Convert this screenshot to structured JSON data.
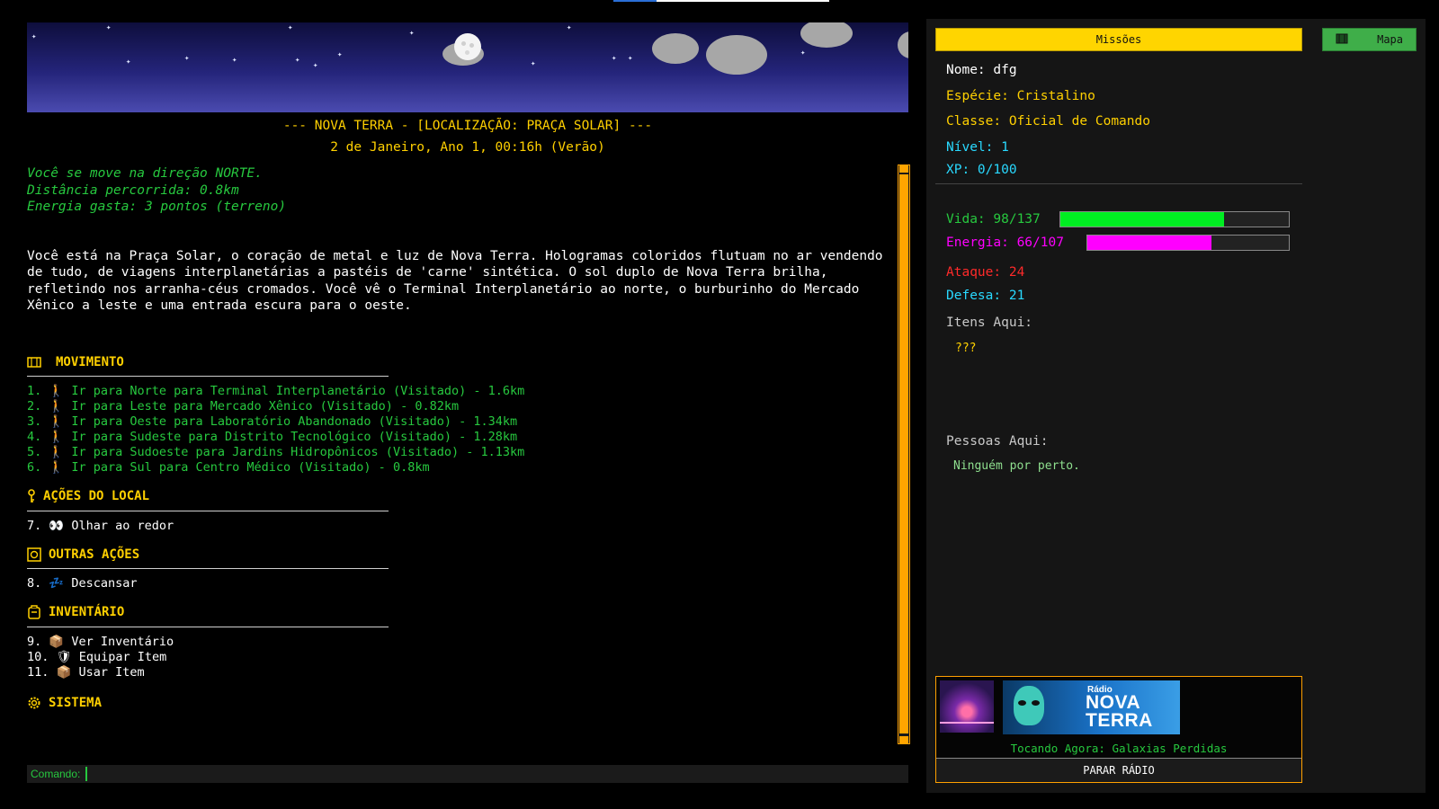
{
  "location_title": "--- NOVA TERRA - [LOCALIZAÇÃO: PRAÇA SOLAR] ---",
  "date_line": "2 de Janeiro, Ano 1, 00:16h (Verão)",
  "movement_messages": [
    "Você se move na direção NORTE.",
    "Distância percorrida: 0.8km",
    "Energia gasta: 3 pontos (terreno)"
  ],
  "description": "Você está na Praça Solar, o coração de metal e luz de Nova Terra. Hologramas coloridos flutuam no ar vendendo de tudo, de viagens interplanetárias a pastéis de 'carne' sintética. O sol duplo de Nova Terra brilha, refletindo nos arranha-céus cromados. Você vê o Terminal Interplanetário ao norte, o burburinho do Mercado Xênico a leste e uma entrada escura para o oeste.",
  "sections": {
    "movimento": {
      "title": "MOVIMENTO",
      "items": [
        "1. 🚶 Ir para Norte para Terminal Interplanetário (Visitado) - 1.6km",
        "2. 🚶 Ir para Leste para Mercado Xênico (Visitado) - 0.82km",
        "3. 🚶 Ir para Oeste para Laboratório Abandonado (Visitado) - 1.34km",
        "4. 🚶 Ir para Sudeste para Distrito Tecnológico (Visitado) - 1.28km",
        "5. 🚶 Ir para Sudoeste para Jardins Hidropônicos (Visitado) - 1.13km",
        "6. 🚶 Ir para Sul para Centro Médico (Visitado) - 0.8km"
      ]
    },
    "acoes_local": {
      "title": "AÇÕES DO LOCAL",
      "items": [
        "7. 👀 Olhar ao redor"
      ]
    },
    "outras_acoes": {
      "title": "OUTRAS AÇÕES",
      "items": [
        "8. 💤 Descansar"
      ]
    },
    "inventario": {
      "title": "INVENTÁRIO",
      "items": [
        "9. 📦 Ver Inventário",
        "10. 🛡   Equipar Item",
        "11. 📦 Usar Item"
      ]
    },
    "sistema": {
      "title": "SISTEMA"
    }
  },
  "command": {
    "label": "Comando:",
    "value": ""
  },
  "panel": {
    "missions_label": "Missões",
    "map_label": "Mapa",
    "nome": "Nome: dfg",
    "especie": "Espécie: Cristalino",
    "classe": "Classe: Oficial de Comando",
    "nivel": "Nível: 1",
    "xp": "XP: 0/100",
    "vida": {
      "label": "Vida: 98/137",
      "current": 98,
      "max": 137
    },
    "energia": {
      "label": "Energia: 66/107",
      "current": 66,
      "max": 107
    },
    "ataque": "Ataque: 24",
    "defesa": "Defesa: 21",
    "itens_label": "Itens Aqui:",
    "itens_value": "???",
    "pessoas_label": "Pessoas Aqui:",
    "pessoas_value": "Ninguém por perto."
  },
  "radio": {
    "logo_small": "Rádio",
    "logo_line1": "NOVA",
    "logo_line2": "TERRA",
    "now_playing": "Tocando Agora: Galaxias Perdidas",
    "stop_label": "PARAR RÁDIO"
  },
  "colors": {
    "accent_yellow": "#ffd000",
    "green": "#27c93f",
    "magenta": "#ff00ff",
    "orange": "#ffa500"
  }
}
